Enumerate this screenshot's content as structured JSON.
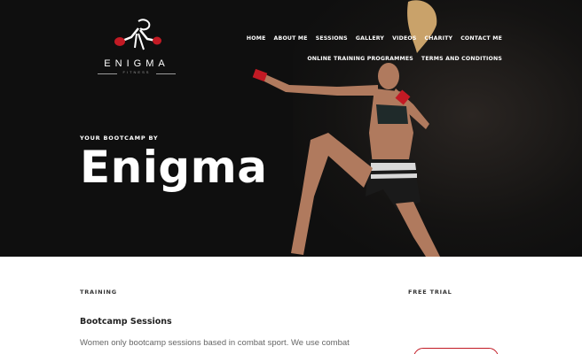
{
  "brand": {
    "name": "ENIGMA",
    "tagline": "FITNESS",
    "accent_color": "#c21a24"
  },
  "nav": {
    "row1": [
      "HOME",
      "ABOUT ME",
      "SESSIONS",
      "GALLERY",
      "VIDEOS",
      "CHARITY",
      "CONTACT ME"
    ],
    "row2": [
      "ONLINE TRAINING PROGRAMMES",
      "TERMS AND CONDITIONS"
    ]
  },
  "hero": {
    "eyebrow": "YOUR BOOTCAMP BY",
    "title": "Enigma"
  },
  "content": {
    "training_label": "TRAINING",
    "sessions_title": "Bootcamp Sessions",
    "sessions_text": "Women only bootcamp sessions based in combat sport. We use combat",
    "free_trial_label": "FREE TRIAL"
  },
  "icons": [
    "boxer-logo-icon"
  ]
}
